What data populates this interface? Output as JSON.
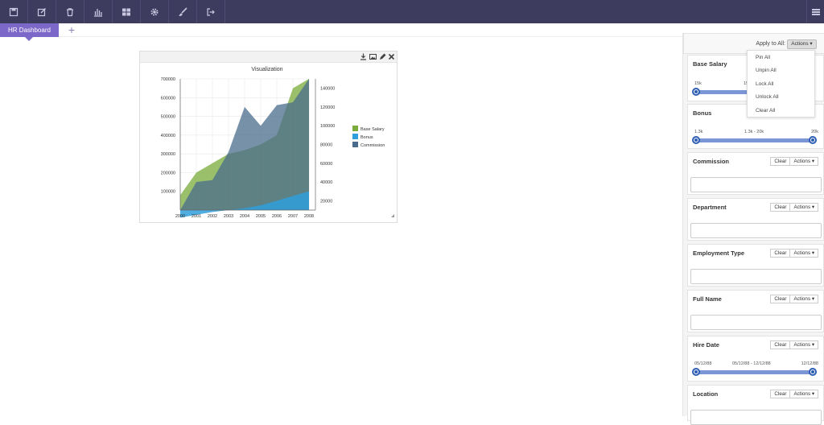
{
  "toolbar": {
    "buttons": [
      {
        "name": "save-icon"
      },
      {
        "name": "edit-icon"
      },
      {
        "name": "trash-icon"
      },
      {
        "name": "bar-chart-icon"
      },
      {
        "name": "widgets-icon"
      },
      {
        "name": "gear-icon"
      },
      {
        "name": "brush-icon"
      },
      {
        "name": "logout-icon"
      }
    ],
    "right_icon": "panel-toggle-icon"
  },
  "tabs": {
    "active": "HR Dashboard",
    "add": "+"
  },
  "widget": {
    "icons": [
      "download-icon",
      "image-icon",
      "pencil-icon",
      "close-icon"
    ]
  },
  "chart_data": {
    "type": "area",
    "title": "Visualization",
    "x": [
      2000,
      2001,
      2002,
      2003,
      2004,
      2005,
      2006,
      2007,
      2008
    ],
    "left_ticks": [
      "700000",
      "600000",
      "500000",
      "400000",
      "300000",
      "200000",
      "100000"
    ],
    "right_ticks": [
      "140000",
      "120000",
      "100000",
      "80000",
      "60000",
      "40000",
      "20000"
    ],
    "ylim_left": [
      0,
      700000
    ],
    "ylim_right": [
      10000,
      150000
    ],
    "series": [
      {
        "name": "Base Salary",
        "color": "#7aab3b",
        "values": [
          80000,
          200000,
          250000,
          300000,
          320000,
          350000,
          400000,
          650000,
          700000
        ]
      },
      {
        "name": "Bonus",
        "color": "#2f9fdc",
        "values": [
          2000,
          5000,
          8000,
          10000,
          12000,
          15000,
          20000,
          25000,
          30000
        ]
      },
      {
        "name": "Commission",
        "color": "#4a6c8c",
        "values": [
          10000,
          40000,
          42000,
          72000,
          120000,
          100000,
          122000,
          125000,
          150000
        ]
      }
    ],
    "grid": true,
    "legend": "right"
  },
  "panel": {
    "apply_label": "Apply to All:",
    "actions_label": "Actions ▾",
    "clear": "Clear",
    "actions": "Actions ▾",
    "base_salary": {
      "title": "Base Salary",
      "min": "15k",
      "max_partial": "15"
    },
    "bonus": {
      "title": "Bonus",
      "min": "1.3k",
      "range": "1.3k - 20k",
      "max": "20k"
    },
    "commission": {
      "title": "Commission"
    },
    "department": {
      "title": "Department"
    },
    "employment_type": {
      "title": "Employment Type"
    },
    "full_name": {
      "title": "Full Name"
    },
    "hire_date": {
      "title": "Hire Date",
      "min": "05/12/88",
      "range": "05/12/88 - 12/12/88",
      "max": "12/12/88"
    },
    "location": {
      "title": "Location"
    }
  },
  "menu": {
    "items": [
      "Pin All",
      "Unpin All",
      "Lock All",
      "Unlock All",
      "Clear All"
    ]
  }
}
